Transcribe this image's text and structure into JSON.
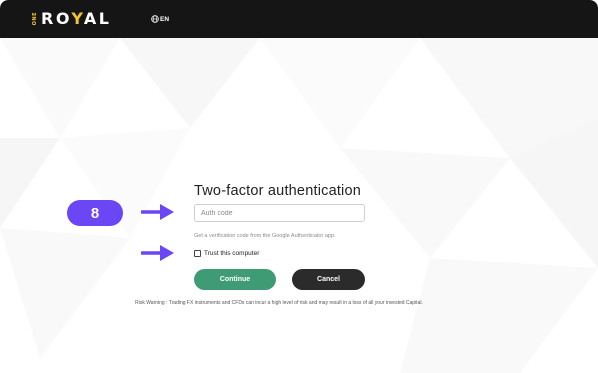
{
  "header": {
    "logo_prefix": "ONE",
    "logo_word_part1": "RO",
    "logo_word_accent": "Y",
    "logo_word_part2": "AL",
    "language": "EN"
  },
  "form": {
    "title": "Two-factor authentication",
    "auth_placeholder": "Auth code",
    "auth_value": "",
    "hint": "Get a verification code from the Google Authenticator app.",
    "trust_label": "Trust this computer",
    "trust_checked": false,
    "continue_label": "Continue",
    "cancel_label": "Cancel"
  },
  "footer": {
    "risk_warning": "Risk Warning : Trading FX instruments and CFDs can incur a high level of risk and may result in a loss of all your invested Capital."
  },
  "annotation": {
    "step_number": "8"
  },
  "colors": {
    "topbar": "#151515",
    "logo_accent": "#f2c230",
    "continue": "#3f9b73",
    "cancel": "#2b2b2b",
    "annotation": "#6b46f5"
  },
  "icons": {
    "language": "globe-icon",
    "pointer": "arrow-right-icon"
  }
}
